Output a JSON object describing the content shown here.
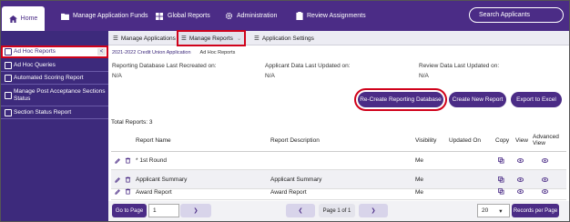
{
  "topbar": {
    "home_label": "Home",
    "nav": [
      {
        "label": "Manage Application Funds",
        "icon": "folder-icon"
      },
      {
        "label": "Global Reports",
        "icon": "grid-icon"
      },
      {
        "label": "Administration",
        "icon": "gear-icon"
      },
      {
        "label": "Review Assignments",
        "icon": "clipboard-icon"
      }
    ],
    "search_placeholder": "Search Applicants"
  },
  "sidebar": {
    "items": [
      {
        "label": "Ad Hoc Reports",
        "active": true
      },
      {
        "label": "Ad Hoc Queries"
      },
      {
        "label": "Automated Scoring Report"
      },
      {
        "label": "Manage Post Acceptance Sections Status"
      },
      {
        "label": "Section Status Report"
      }
    ],
    "collapse_glyph": "<"
  },
  "subnav": {
    "items": [
      {
        "label": "Manage Applications"
      },
      {
        "label": "Manage Reports",
        "selected": true
      },
      {
        "label": "Application Settings"
      }
    ]
  },
  "breadcrumb": {
    "first": "2021-2022 Credit Union Application",
    "second": "Ad Hoc Reports"
  },
  "info": {
    "reporting_db_label": "Reporting Database Last Recreated on:",
    "reporting_db_value": "N/A",
    "applicant_label": "Applicant Data Last Updated on:",
    "applicant_value": "N/A",
    "review_label": "Review Data Last Updated on:",
    "review_value": "N/A"
  },
  "actions": {
    "recreate": "Re-Create Reporting Database",
    "create": "Create New Report",
    "export": "Export to Excel"
  },
  "table": {
    "total": "Total Reports: 3",
    "headers": {
      "name": "Report Name",
      "description": "Report Description",
      "visibility": "Visibility",
      "updated": "Updated On",
      "copy": "Copy",
      "view": "View",
      "advanced": "Advanced View"
    },
    "rows": [
      {
        "name": "* 1st Round",
        "description": "",
        "visibility": "Me"
      },
      {
        "name": "Applicant Summary",
        "description": "Applicant Summary",
        "visibility": "Me"
      },
      {
        "name": "Award Report",
        "description": "Award Report",
        "visibility": "Me"
      }
    ]
  },
  "pager": {
    "go_label": "Go to Page",
    "page_value": "1",
    "page_info": "Page 1 of 1",
    "per_page_value": "20",
    "per_page_label": "Records per Page"
  },
  "colors": {
    "brand": "#4b2c86",
    "highlight": "#d0021b"
  }
}
